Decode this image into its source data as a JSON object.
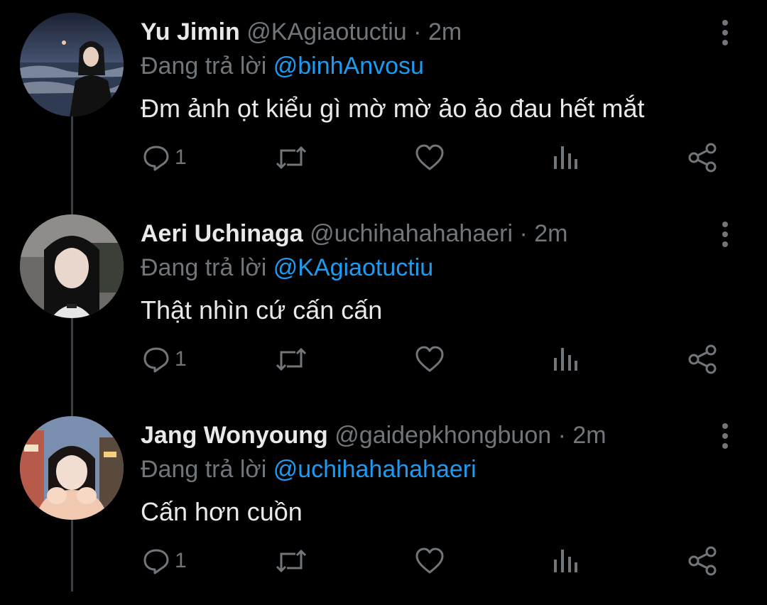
{
  "colors": {
    "background": "#000000",
    "text": "#e7e9ea",
    "muted": "#71767b",
    "accent": "#1d9bf0",
    "thread_line": "#3a3f44"
  },
  "tweets": [
    {
      "name": "Yu Jimin",
      "handle": "@KAgiaotuctiu",
      "separator": "·",
      "time": "2m",
      "reply_prefix": "Đang trả lời",
      "reply_to": "@binhAnvosu",
      "text": "Đm ảnh ọt kiểu gì mờ mờ ảo ảo đau hết mắt",
      "reply_count": "1",
      "icons": [
        "reply-icon",
        "retweet-icon",
        "like-icon",
        "views-icon",
        "share-icon",
        "more-icon"
      ]
    },
    {
      "name": "Aeri Uchinaga",
      "handle": "@uchihahahahaeri",
      "separator": "·",
      "time": "2m",
      "reply_prefix": "Đang trả lời",
      "reply_to": "@KAgiaotuctiu",
      "text": "Thật nhìn cứ cấn cấn",
      "reply_count": "1",
      "icons": [
        "reply-icon",
        "retweet-icon",
        "like-icon",
        "views-icon",
        "share-icon",
        "more-icon"
      ]
    },
    {
      "name": "Jang Wonyoung",
      "handle": "@gaidepkhongbuon",
      "separator": "·",
      "time": "2m",
      "reply_prefix": "Đang trả lời",
      "reply_to": "@uchihahahahaeri",
      "text": "Cấn hơn cuồn",
      "reply_count": "1",
      "icons": [
        "reply-icon",
        "retweet-icon",
        "like-icon",
        "views-icon",
        "share-icon",
        "more-icon"
      ]
    }
  ]
}
